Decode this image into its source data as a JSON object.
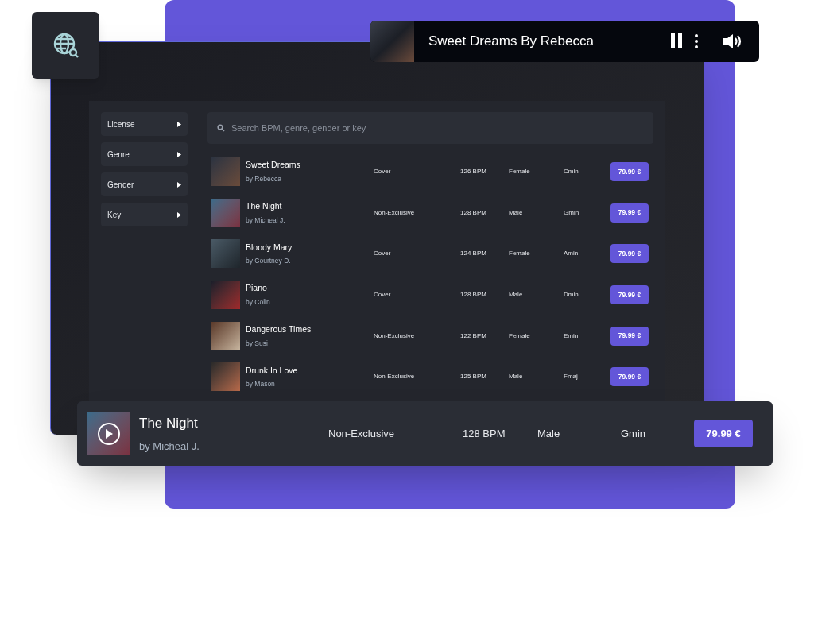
{
  "player": {
    "title": "Sweet Dreams By Rebecca"
  },
  "filters": [
    {
      "label": "License"
    },
    {
      "label": "Genre"
    },
    {
      "label": "Gender"
    },
    {
      "label": "Key"
    }
  ],
  "search": {
    "placeholder": "Search BPM, genre, gender or key"
  },
  "tracks": [
    {
      "title": "Sweet Dreams",
      "artist": "by Rebecca",
      "license": "Cover",
      "bpm": "126 BPM",
      "gender": "Female",
      "key": "Cmin",
      "price": "79.99 €"
    },
    {
      "title": "The Night",
      "artist": "by Micheal J.",
      "license": "Non-Exclusive",
      "bpm": "128 BPM",
      "gender": "Male",
      "key": "Gmin",
      "price": "79.99 €"
    },
    {
      "title": "Bloody Mary",
      "artist": "by Courtney D.",
      "license": "Cover",
      "bpm": "124 BPM",
      "gender": "Female",
      "key": "Amin",
      "price": "79.99 €"
    },
    {
      "title": "Piano",
      "artist": "by Colin",
      "license": "Cover",
      "bpm": "128 BPM",
      "gender": "Male",
      "key": "Dmin",
      "price": "79.99 €"
    },
    {
      "title": "Dangerous Times",
      "artist": "by Susi",
      "license": "Non-Exclusive",
      "bpm": "122 BPM",
      "gender": "Female",
      "key": "Emin",
      "price": "79.99 €"
    },
    {
      "title": "Drunk In Love",
      "artist": "by Mason",
      "license": "Non-Exclusive",
      "bpm": "125 BPM",
      "gender": "Male",
      "key": "Fmaj",
      "price": "79.99 €"
    }
  ],
  "featured": {
    "title": "The Night",
    "artist": "by Micheal J.",
    "license": "Non-Exclusive",
    "bpm": "128 BPM",
    "gender": "Male",
    "key": "Gmin",
    "price": "79.99 €"
  }
}
